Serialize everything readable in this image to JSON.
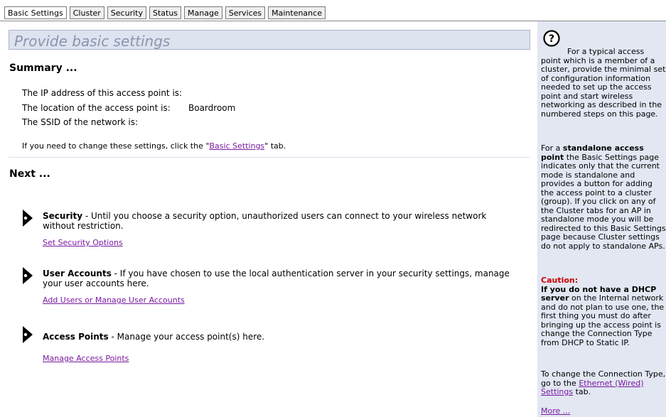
{
  "tabs": [
    {
      "label": "Basic Settings",
      "active": true
    },
    {
      "label": "Cluster"
    },
    {
      "label": "Security"
    },
    {
      "label": "Status"
    },
    {
      "label": "Manage"
    },
    {
      "label": "Services"
    },
    {
      "label": "Maintenance"
    }
  ],
  "main": {
    "banner": "Provide basic settings",
    "summary_heading": "Summary ...",
    "summary": [
      {
        "label": "The IP address of this access point is:",
        "value": ""
      },
      {
        "label": "The location of the access point is:",
        "value": "Boardroom"
      },
      {
        "label": "The SSID of the network is:",
        "value": ""
      }
    ],
    "note_before": "If you need to change these settings, click the \"",
    "note_link": "Basic Settings",
    "note_after": "\" tab.",
    "next_heading": "Next ...",
    "items": [
      {
        "title": "Security",
        "text": " - Until you choose a security option, unauthorized users can connect to your wireless network without restriction.",
        "link": "Set Security Options"
      },
      {
        "title": "User Accounts",
        "text": " - If you have chosen to use the local authentication server in your security settings, manage your user accounts here.",
        "link": "Add Users or Manage User Accounts"
      },
      {
        "title": "Access Points",
        "text": " - Manage your access point(s) here.",
        "link": "Manage Access Points"
      }
    ]
  },
  "help": {
    "icon": "question-circle-icon",
    "p1": "For a typical access point which is a member of a cluster, provide the minimal set of configuration information needed to set up the access point and start wireless networking as described in the numbered steps on this page.",
    "p2_intro": "For a ",
    "p2_bold": "standalone access point",
    "p2_rest": " the Basic Settings page indicates only that the current mode is standalone and provides a button for adding the access point to a cluster (group). If you click on any of the Cluster tabs for an AP in standalone mode you will be redirected to this Basic Settings page because Cluster settings do not apply to standalone APs.",
    "caution_label": "Caution:",
    "caution_bold": "If you do not have a DHCP server",
    "caution_rest": " on the Internal network and do not plan to use one, the first thing you must do after bringing up the access point is change the Connection Type from DHCP to Static IP.",
    "p4_before": "To change the Connection Type, go to the ",
    "p4_link": "Ethernet (Wired) Settings",
    "p4_after": " tab.",
    "more": "More ..."
  },
  "colors": {
    "link": "#7a1aa0",
    "caution": "#cc0000",
    "help_bg": "#e2e7f2",
    "banner_bg": "#dde3ef"
  }
}
